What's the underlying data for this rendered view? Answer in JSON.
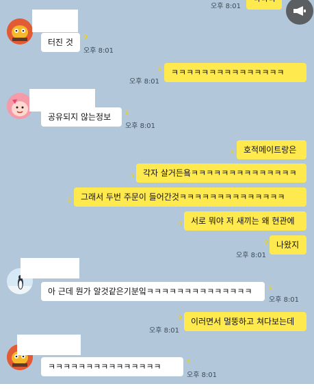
{
  "chat": {
    "messages": [
      {
        "text": "ㅋㅋㅋㅋㅋㅋㅋㅋㅋㅋㅋㅋㅋㅋㅋ",
        "time": "오후 8:01",
        "count": "9"
      },
      {
        "text": "터진 것",
        "time": "오후 8:01",
        "count": "9"
      },
      {
        "text": "ㅋㅋㅋㅋㅋㅋㅋㅋㅋㅋㅋㅋㅋㅋㅋ",
        "time": "오후 8:01",
        "count": "9"
      },
      {
        "text": "공유되지 않는정보",
        "time": "오후 8:01",
        "count": "9"
      },
      {
        "text": "호적메이트랑은",
        "count": "9"
      },
      {
        "text": "각자 살거든욬ㅋㅋㅋㅋㅋㅋㅋㅋㅋㅋㅋㅋㅋㅋ",
        "count": "9"
      },
      {
        "text": "그래서 두번 주문이 들어간것ㅋㅋㅋㅋㅋㅋㅋㅋㅋㅋㅋㅋㅋㅋ",
        "count": "9"
      },
      {
        "text": "서로 뭐야 저 새끼는 왜 현관에",
        "count": "9"
      },
      {
        "text": "나왔지",
        "time": "오후 8:01",
        "count": "9"
      },
      {
        "text": "아 근데 뭔가 알것같은기분잌ㅋㅋㅋㅋㅋㅋㅋㅋㅋㅋㅋㅋㅋㅋ",
        "time": "오후 8:01",
        "count": "9"
      },
      {
        "text": "이러면서 멀뚱하고 쳐다보는데",
        "time": "오후 8:01",
        "count": "9"
      },
      {
        "text": "ㅋㅋㅋㅋㅋㅋㅋㅋㅋㅋㅋㅋㅋㅋㅋ",
        "time": "오후 8:01",
        "count": "9"
      }
    ]
  },
  "colors": {
    "background": "#b2c7da",
    "my_bubble": "#fee94e",
    "their_bubble": "#ffffff"
  },
  "icons": {
    "fab": "megaphone-icon"
  }
}
